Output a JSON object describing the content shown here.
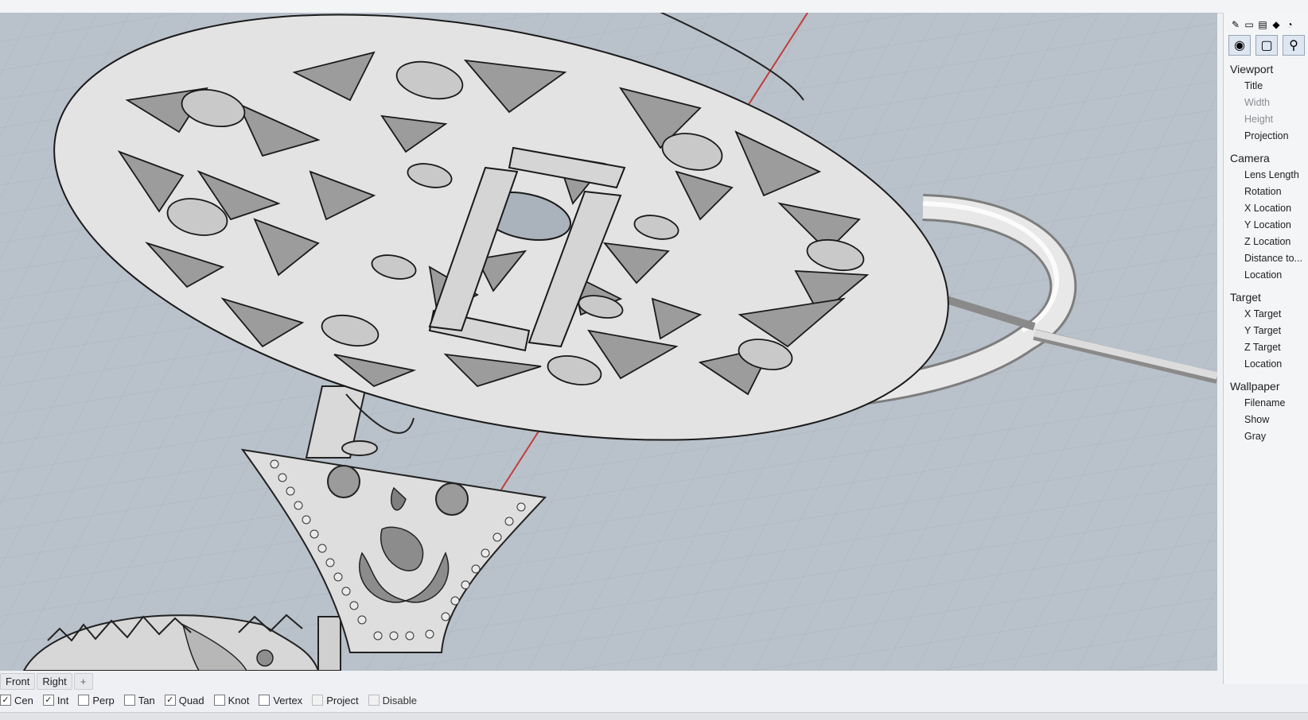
{
  "viewport_tabs": {
    "front": "Front",
    "right": "Right",
    "add": "+"
  },
  "osnaps": [
    {
      "label": "Cen",
      "checked": true
    },
    {
      "label": "Int",
      "checked": true
    },
    {
      "label": "Perp",
      "checked": false
    },
    {
      "label": "Tan",
      "checked": false
    },
    {
      "label": "Quad",
      "checked": true
    },
    {
      "label": "Knot",
      "checked": false
    },
    {
      "label": "Vertex",
      "checked": false
    },
    {
      "label": "Project",
      "checked": false
    }
  ],
  "osnap_disable": "Disable",
  "panel": {
    "viewport": {
      "header": "Viewport",
      "title": "Title",
      "width": "Width",
      "height": "Height",
      "projection": "Projection"
    },
    "camera": {
      "header": "Camera",
      "lens_length": "Lens Length",
      "rotation": "Rotation",
      "x_location": "X Location",
      "y_location": "Y Location",
      "z_location": "Z Location",
      "distance": "Distance to...",
      "location": "Location"
    },
    "target": {
      "header": "Target",
      "x_target": "X Target",
      "y_target": "Y Target",
      "z_target": "Z Target",
      "location": "Location"
    },
    "wallpaper": {
      "header": "Wallpaper",
      "filename": "Filename",
      "show": "Show",
      "gray": "Gray"
    }
  },
  "colors": {
    "viewport_bg": "#b9c1ca",
    "axis_red": "#c43c3c",
    "panel_bg": "#f4f5f7"
  }
}
